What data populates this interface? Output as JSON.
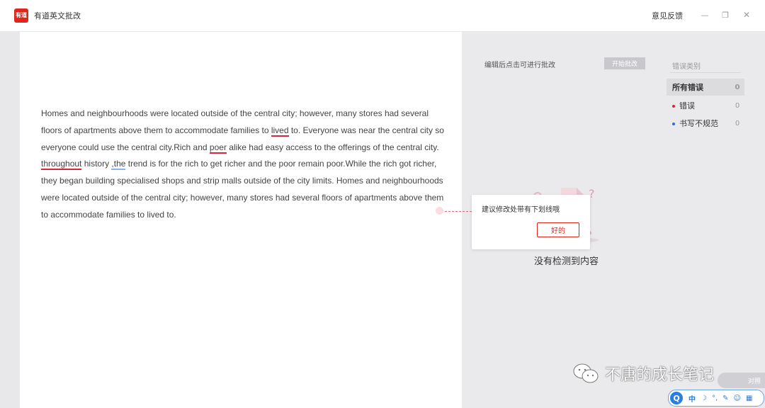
{
  "app": {
    "logo_text": "有道",
    "title": "有道英文批改",
    "feedback": "意见反馈"
  },
  "window_controls": {
    "minimize": "—",
    "maximize": "❐",
    "close": "✕"
  },
  "essay": {
    "seg1": "Homes and neighbourhoods were located outside of the central city; however, many stores had several floors of apartments above them to accommodate families to ",
    "err1": "lived",
    "seg2": " to. Everyone was near the central city so everyone could use the central city.Rich and ",
    "err2": "poer",
    "seg3": " alike had easy access to the offerings of the central city. ",
    "err3": "throughout",
    "seg4": " history ",
    "err4": ",the",
    "seg5": " trend is for the rich to get richer and the poor remain poor.While the rich got richer, they began building specialised shops and strip malls outside of the city limits. Homes and neighbourhoods were located outside of the central city; however, many stores had several floors of apartments above them to accommodate families to lived to."
  },
  "panel": {
    "hint": "编辑后点击可进行批改",
    "start_button": "开始批改",
    "category_title": "错误类别",
    "categories": [
      {
        "label": "所有错误",
        "count": "0"
      },
      {
        "label": "错误",
        "count": "0",
        "color": "#d9263c"
      },
      {
        "label": "书写不规范",
        "count": "0",
        "color": "#2a6cd8"
      }
    ],
    "empty_text": "没有检测到内容"
  },
  "tooltip": {
    "text": "建议修改处带有下划线哦",
    "ok_button": "好的"
  },
  "watermark": {
    "text": "不唐的成长笔记"
  },
  "ime": {
    "logo": "Q",
    "items": [
      "中",
      "☽",
      "°,",
      "✎",
      "☺",
      "▦"
    ]
  },
  "side_tab": {
    "label": "对照"
  },
  "colors": {
    "brand": "#e0251b",
    "error_underline": "#d9263c",
    "style_underline": "#8ab4ea"
  }
}
